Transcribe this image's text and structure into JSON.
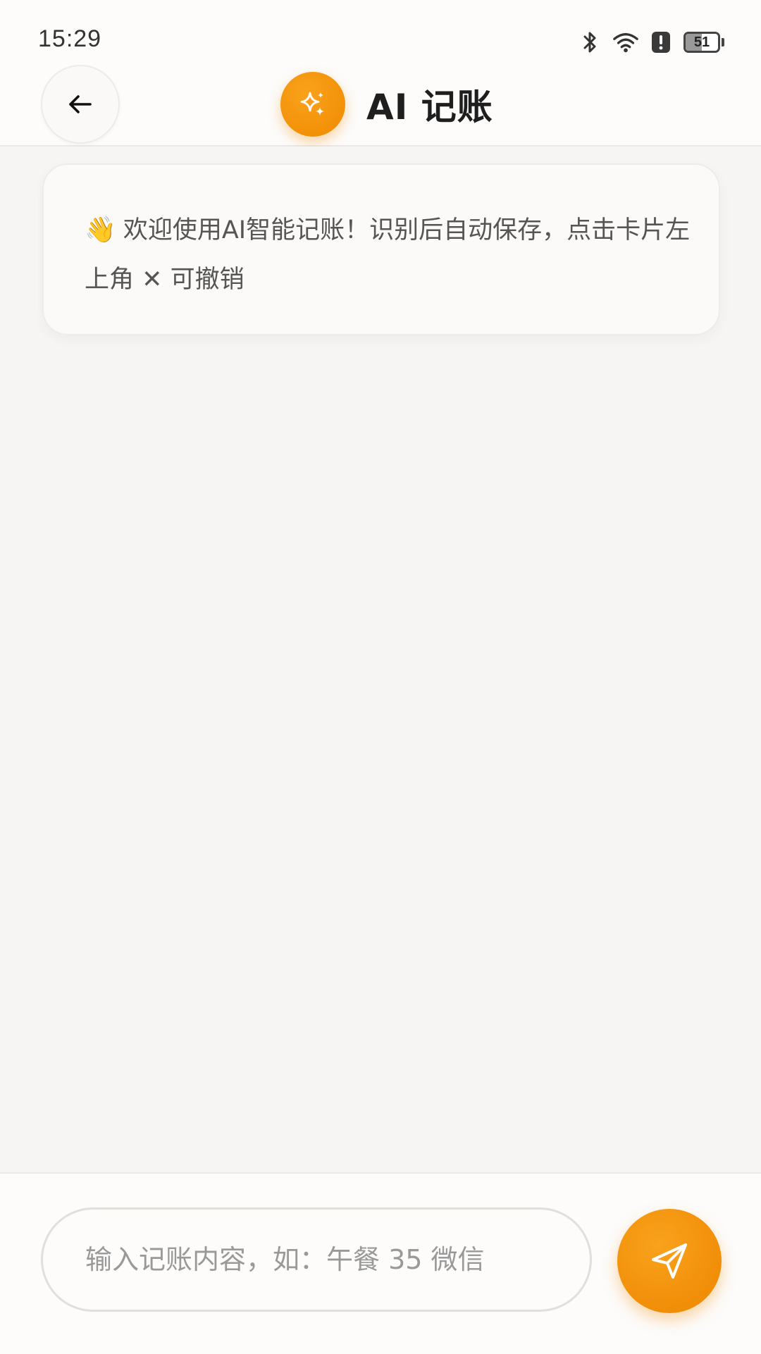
{
  "status_bar": {
    "time": "15:29",
    "battery_level": "51",
    "icons": [
      "bluetooth-icon",
      "wifi-icon",
      "alert-icon",
      "battery-icon"
    ]
  },
  "header": {
    "title": "AI 记账",
    "back_icon": "arrow-left-icon",
    "badge_icon": "sparkle-icon"
  },
  "chat": {
    "welcome_emoji": "👋",
    "welcome_line": "欢迎使用AI智能记账！识别后自动保存，点击卡片左上角 ✕ 可撤销"
  },
  "input_bar": {
    "value": "",
    "placeholder": "输入记账内容，如：午餐 35 微信",
    "send_icon": "send-icon"
  },
  "colors": {
    "accent": "#f39200",
    "background": "#f7f5f3",
    "card": "#fbfaf8",
    "text_muted": "#555555",
    "placeholder": "#999999"
  }
}
